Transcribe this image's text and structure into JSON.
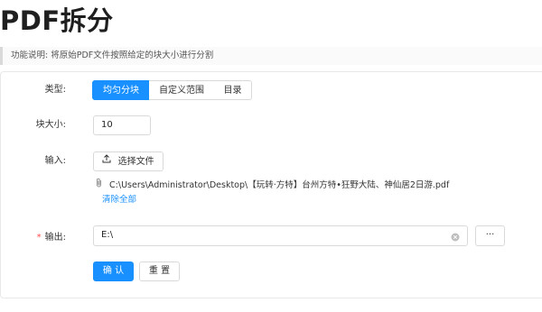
{
  "page": {
    "title": "PDF拆分",
    "description": "功能说明: 将原始PDF文件按照给定的块大小进行分割"
  },
  "form": {
    "type_label": "类型:",
    "type_options": [
      "均匀分块",
      "自定义范围",
      "目录"
    ],
    "type_selected": "均匀分块",
    "chunk_label": "块大小:",
    "chunk_value": "10",
    "input_label": "输入:",
    "select_file_label": "选择文件",
    "file_path": "C:\\Users\\Administrator\\Desktop\\【玩转·方特】台州方特•狂野大陆、神仙居2日游.pdf",
    "clear_all_label": "清除全部",
    "output_label": "输出:",
    "output_required_mark": "*",
    "output_value": "E:\\",
    "browse_label": "···",
    "confirm_label": "确 认",
    "reset_label": "重 置"
  },
  "colors": {
    "accent": "#1890ff",
    "required": "#ff4d4f"
  },
  "icons": {
    "upload": "upload-icon",
    "attachment": "paperclip-icon",
    "clear": "clear-circle-icon"
  }
}
